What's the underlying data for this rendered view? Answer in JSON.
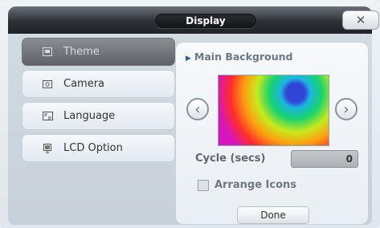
{
  "window": {
    "title": "Display",
    "close_glyph": "✕"
  },
  "nav": {
    "items": [
      {
        "label": "Theme",
        "icon": "theme-icon",
        "active": true
      },
      {
        "label": "Camera",
        "icon": "camera-icon",
        "active": false
      },
      {
        "label": "Language",
        "icon": "language-icon",
        "active": false
      },
      {
        "label": "LCD Option",
        "icon": "lcd-icon",
        "active": false
      }
    ]
  },
  "panel": {
    "title": "Main Background",
    "prev_glyph": "‹",
    "next_glyph": "›",
    "cycle": {
      "label": "Cycle (secs)",
      "value": "0"
    },
    "arrange_icons": {
      "label": "Arrange Icons",
      "checked": false
    },
    "done_label": "Done"
  }
}
